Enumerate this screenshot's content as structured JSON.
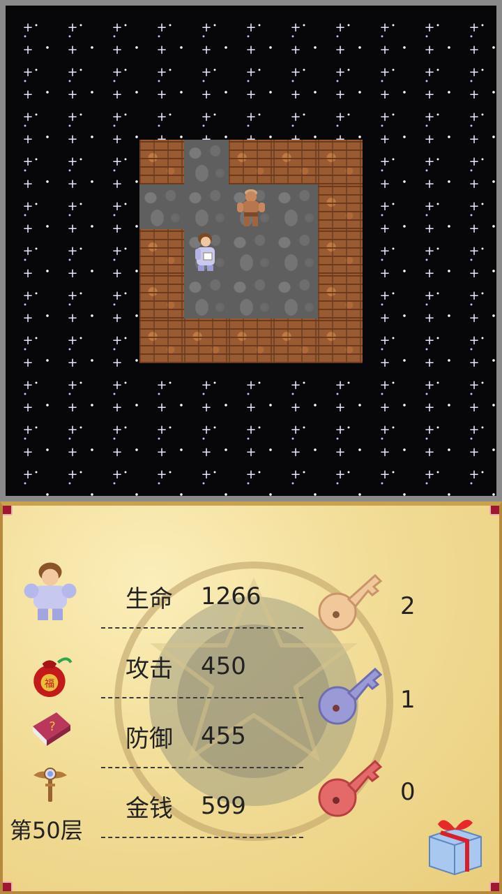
{
  "status": {
    "stats": [
      {
        "label": "生命",
        "value": "1266"
      },
      {
        "label": "攻击",
        "value": "450"
      },
      {
        "label": "防御",
        "value": "455"
      },
      {
        "label": "金钱",
        "value": "599"
      }
    ],
    "floor": "第50层",
    "keys": {
      "yellow": "2",
      "blue": "1",
      "red": "0"
    }
  },
  "colors": {
    "panel_bg": "#efd88e",
    "wall": "#9a5b32",
    "floor": "#5f5f5f",
    "space": "#07070a"
  },
  "icons": [
    "hero-portrait-icon",
    "lucky-bag-icon",
    "monster-book-icon",
    "fly-wand-icon",
    "yellow-key-icon",
    "blue-key-icon",
    "red-key-icon",
    "gift-box-icon"
  ]
}
